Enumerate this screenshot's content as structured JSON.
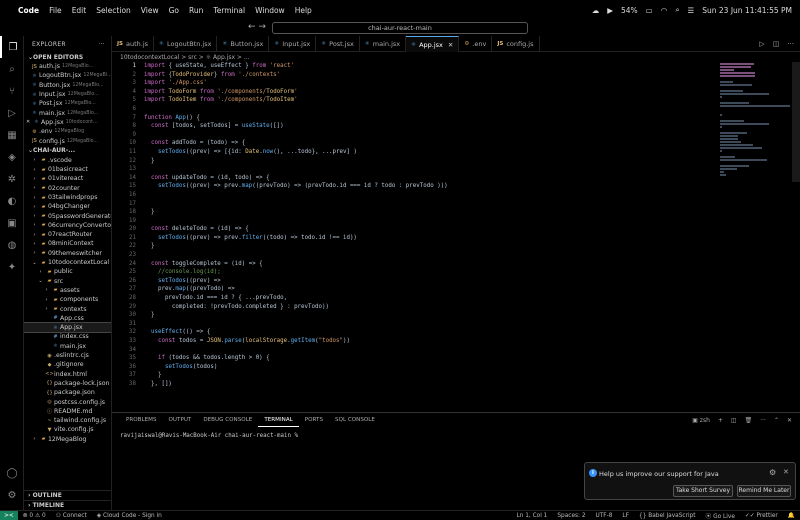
{
  "menubar": {
    "app": "Code",
    "items": [
      "File",
      "Edit",
      "Selection",
      "View",
      "Go",
      "Run",
      "Terminal",
      "Window",
      "Help"
    ],
    "battery": "54%",
    "datetime": "Sun 23 Jun  11:41:55 PM"
  },
  "titlebar": {
    "search": "chai-aur-react-main"
  },
  "sidebar": {
    "title": "EXPLORER",
    "open_editors_label": "OPEN EDITORS",
    "open_editors": [
      {
        "name": "auth.js",
        "sub": "12MegaBlo...",
        "icon": "JS"
      },
      {
        "name": "LogoutBtn.jsx",
        "sub": "12MegaBl...",
        "icon": "⚛"
      },
      {
        "name": "Button.jsx",
        "sub": "12MegaBlo...",
        "icon": "⚛"
      },
      {
        "name": "Input.jsx",
        "sub": "12MegaBlo...",
        "icon": "⚛"
      },
      {
        "name": "Post.jsx",
        "sub": "12MegaBlo...",
        "icon": "⚛"
      },
      {
        "name": "main.jsx",
        "sub": "12MegaBlo...",
        "icon": "⚛"
      },
      {
        "name": "App.jsx",
        "sub": "10todocont...",
        "icon": "⚛"
      },
      {
        "name": ".env",
        "sub": "12MegaBlog",
        "icon": "⚙"
      },
      {
        "name": "config.js",
        "sub": "12MegaBlo...",
        "icon": "JS"
      }
    ],
    "project_label": "CHAI-AUR-...",
    "tree": [
      {
        "name": ".vscode",
        "depth": 1,
        "folder": true
      },
      {
        "name": "01basicreact",
        "depth": 1,
        "folder": true
      },
      {
        "name": "01vitereact",
        "depth": 1,
        "folder": true
      },
      {
        "name": "02counter",
        "depth": 1,
        "folder": true
      },
      {
        "name": "03tailwindprops",
        "depth": 1,
        "folder": true
      },
      {
        "name": "04bgChanger",
        "depth": 1,
        "folder": true
      },
      {
        "name": "05passwordGenerator",
        "depth": 1,
        "folder": true
      },
      {
        "name": "06currencyConvertor",
        "depth": 1,
        "folder": true
      },
      {
        "name": "07reactRouter",
        "depth": 1,
        "folder": true
      },
      {
        "name": "08miniContext",
        "depth": 1,
        "folder": true
      },
      {
        "name": "09themeswitcher",
        "depth": 1,
        "folder": true
      },
      {
        "name": "10todocontextLocal",
        "depth": 1,
        "folder": true,
        "open": true
      },
      {
        "name": "public",
        "depth": 2,
        "folder": true
      },
      {
        "name": "src",
        "depth": 2,
        "folder": true,
        "open": true
      },
      {
        "name": "assets",
        "depth": 3,
        "folder": true
      },
      {
        "name": "components",
        "depth": 3,
        "folder": true
      },
      {
        "name": "contexts",
        "depth": 3,
        "folder": true
      },
      {
        "name": "App.css",
        "depth": 3,
        "folder": false,
        "icon": "#"
      },
      {
        "name": "App.jsx",
        "depth": 3,
        "folder": false,
        "icon": "⚛",
        "selected": true
      },
      {
        "name": "index.css",
        "depth": 3,
        "folder": false,
        "icon": "#"
      },
      {
        "name": "main.jsx",
        "depth": 3,
        "folder": false,
        "icon": "⚛"
      },
      {
        "name": ".eslintrc.cjs",
        "depth": 2,
        "folder": false,
        "icon": "◉"
      },
      {
        "name": ".gitignore",
        "depth": 2,
        "folder": false,
        "icon": "◆"
      },
      {
        "name": "index.html",
        "depth": 2,
        "folder": false,
        "icon": "<>"
      },
      {
        "name": "package-lock.json",
        "depth": 2,
        "folder": false,
        "icon": "{}"
      },
      {
        "name": "package.json",
        "depth": 2,
        "folder": false,
        "icon": "{}"
      },
      {
        "name": "postcss.config.js",
        "depth": 2,
        "folder": false,
        "icon": "◎"
      },
      {
        "name": "README.md",
        "depth": 2,
        "folder": false,
        "icon": "ⓘ"
      },
      {
        "name": "tailwind.config.js",
        "depth": 2,
        "folder": false,
        "icon": "~"
      },
      {
        "name": "vite.config.js",
        "depth": 2,
        "folder": false,
        "icon": "▼"
      },
      {
        "name": "12MegaBlog",
        "depth": 1,
        "folder": true
      }
    ],
    "outline": "OUTLINE",
    "timeline": "TIMELINE"
  },
  "tabs": [
    {
      "name": "auth.js",
      "icon": "JS"
    },
    {
      "name": "LogoutBtn.jsx",
      "icon": "⚛"
    },
    {
      "name": "Button.jsx",
      "icon": "⚛"
    },
    {
      "name": "Input.jsx",
      "icon": "⚛"
    },
    {
      "name": "Post.jsx",
      "icon": "⚛"
    },
    {
      "name": "main.jsx",
      "icon": "⚛"
    },
    {
      "name": "App.jsx",
      "icon": "⚛",
      "active": true
    },
    {
      "name": ".env",
      "icon": "⚙"
    },
    {
      "name": "config.js",
      "icon": "JS"
    }
  ],
  "breadcrumb": "10todocontextLocal  >  src  >  ⚛ App.jsx  >  ...",
  "code_lines": [
    "import { useState, useEffect } from 'react'",
    "import {TodoProvider} from './contexts'",
    "import './App.css'",
    "import TodoForm from './components/TodoForm'",
    "import TodoItem from './components/TodoItem'",
    "",
    "function App() {",
    "  const [todos, setTodos] = useState([])",
    "",
    "  const addTodo = (todo) => {",
    "    setTodos((prev) => [{id: Date.now(), ...todo}, ...prev] )",
    "  }",
    "",
    "  const updateTodo = (id, todo) => {",
    "    setTodos((prev) => prev.map((prevTodo) => (prevTodo.id === id ? todo : prevTodo )))",
    "",
    "",
    "  }",
    "",
    "  const deleteTodo = (id) => {",
    "    setTodos((prev) => prev.filter((todo) => todo.id !== id))",
    "  }",
    "",
    "  const toggleComplete = (id) => {",
    "    //console.log(id);",
    "    setTodos((prev) =>",
    "    prev.map((prevTodo) =>",
    "      prevTodo.id === id ? { ...prevTodo,",
    "        completed: !prevTodo.completed } : prevTodo))",
    "  }",
    "",
    "  useEffect(() => {",
    "    const todos = JSON.parse(localStorage.getItem(\"todos\"))",
    "",
    "    if (todos && todos.length > 0) {",
    "      setTodos(todos)",
    "    }",
    "  }, [])"
  ],
  "current_line": 1,
  "panel": {
    "tabs": [
      "PROBLEMS",
      "OUTPUT",
      "DEBUG CONSOLE",
      "TERMINAL",
      "PORTS",
      "SQL CONSOLE"
    ],
    "active_tab": "TERMINAL",
    "shell": "zsh",
    "prompt": "ravijaiswal@Ravis-MacBook-Air chai-aur-react-main %"
  },
  "notification": {
    "message": "Help us improve our support for Java",
    "btn_survey": "Take Short Survey",
    "btn_remind": "Remind Me Later"
  },
  "status": {
    "errors": "0",
    "warnings": "0",
    "connect": "Connect",
    "cloud": "Cloud Code - Sign in",
    "position": "Ln 1, Col 1",
    "spaces": "Spaces: 2",
    "encoding": "UTF-8",
    "eol": "LF",
    "language": "Babel JavaScript",
    "golive": "Go Live",
    "prettier": "Prettier"
  },
  "colors": {
    "accent": "#5aa9e6",
    "folder": "#d9a44a",
    "info": "#3794ff"
  }
}
